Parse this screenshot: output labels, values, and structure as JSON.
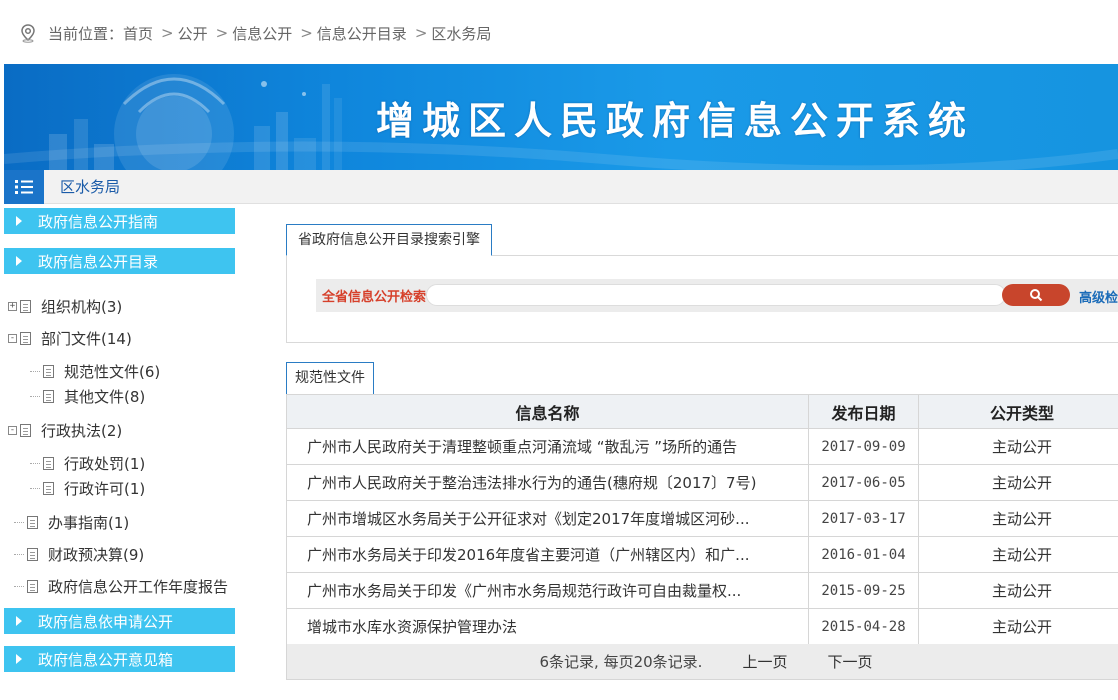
{
  "breadcrumb": {
    "prefix": "当前位置：",
    "items": [
      "首页",
      "公开",
      "信息公开",
      "信息公开目录",
      "区水务局"
    ],
    "separator": ">"
  },
  "banner": {
    "title": "增城区人民政府信息公开系统"
  },
  "unit": {
    "name": "区水务局"
  },
  "sidebar": {
    "headers": [
      "政府信息公开指南",
      "政府信息公开目录",
      "政府信息依申请公开",
      "政府信息公开意见箱"
    ],
    "tree": [
      {
        "label": "组织机构(3)",
        "level": 0,
        "expander": "+"
      },
      {
        "label": "部门文件(14)",
        "level": 0,
        "expander": "-"
      },
      {
        "label": "规范性文件(6)",
        "level": 1
      },
      {
        "label": "其他文件(8)",
        "level": 1
      },
      {
        "label": "行政执法(2)",
        "level": 0,
        "expander": "-"
      },
      {
        "label": "行政处罚(1)",
        "level": 1
      },
      {
        "label": "行政许可(1)",
        "level": 1
      },
      {
        "label": "办事指南(1)",
        "level": 0
      },
      {
        "label": "财政预决算(9)",
        "level": 0
      },
      {
        "label": "政府信息公开工作年度报告",
        "level": 0
      }
    ]
  },
  "search": {
    "tab_label": "省政府信息公开目录搜索引擎",
    "label": "全省信息公开检索",
    "placeholder": "",
    "advanced": "高级检索"
  },
  "documents": {
    "tab_label": "规范性文件",
    "columns": [
      "信息名称",
      "发布日期",
      "公开类型"
    ],
    "rows": [
      {
        "title": "广州市人民政府关于清理整顿重点河涌流域 “散乱污 ”场所的通告",
        "date": "2017-09-09",
        "type": "主动公开"
      },
      {
        "title": "广州市人民政府关于整治违法排水行为的通告(穗府规〔2017〕7号)",
        "date": "2017-06-05",
        "type": "主动公开"
      },
      {
        "title": "广州市增城区水务局关于公开征求对《划定2017年度增城区河砂...",
        "date": "2017-03-17",
        "type": "主动公开"
      },
      {
        "title": "广州市水务局关于印发2016年度省主要河道（广州辖区内）和广...",
        "date": "2016-01-04",
        "type": "主动公开"
      },
      {
        "title": "广州市水务局关于印发《广州市水务局规范行政许可自由裁量权...",
        "date": "2015-09-25",
        "type": "主动公开"
      },
      {
        "title": "增城市水库水资源保护管理办法",
        "date": "2015-04-28",
        "type": "主动公开"
      }
    ],
    "pager": {
      "summary": "6条记录, 每页20条记录.",
      "prev": "上一页",
      "next": "下一页"
    }
  },
  "colors": {
    "accent": "#1a74c9",
    "sidebar_header": "#3ec4f0",
    "search_label": "#d6402b",
    "search_button": "#c8452c"
  }
}
